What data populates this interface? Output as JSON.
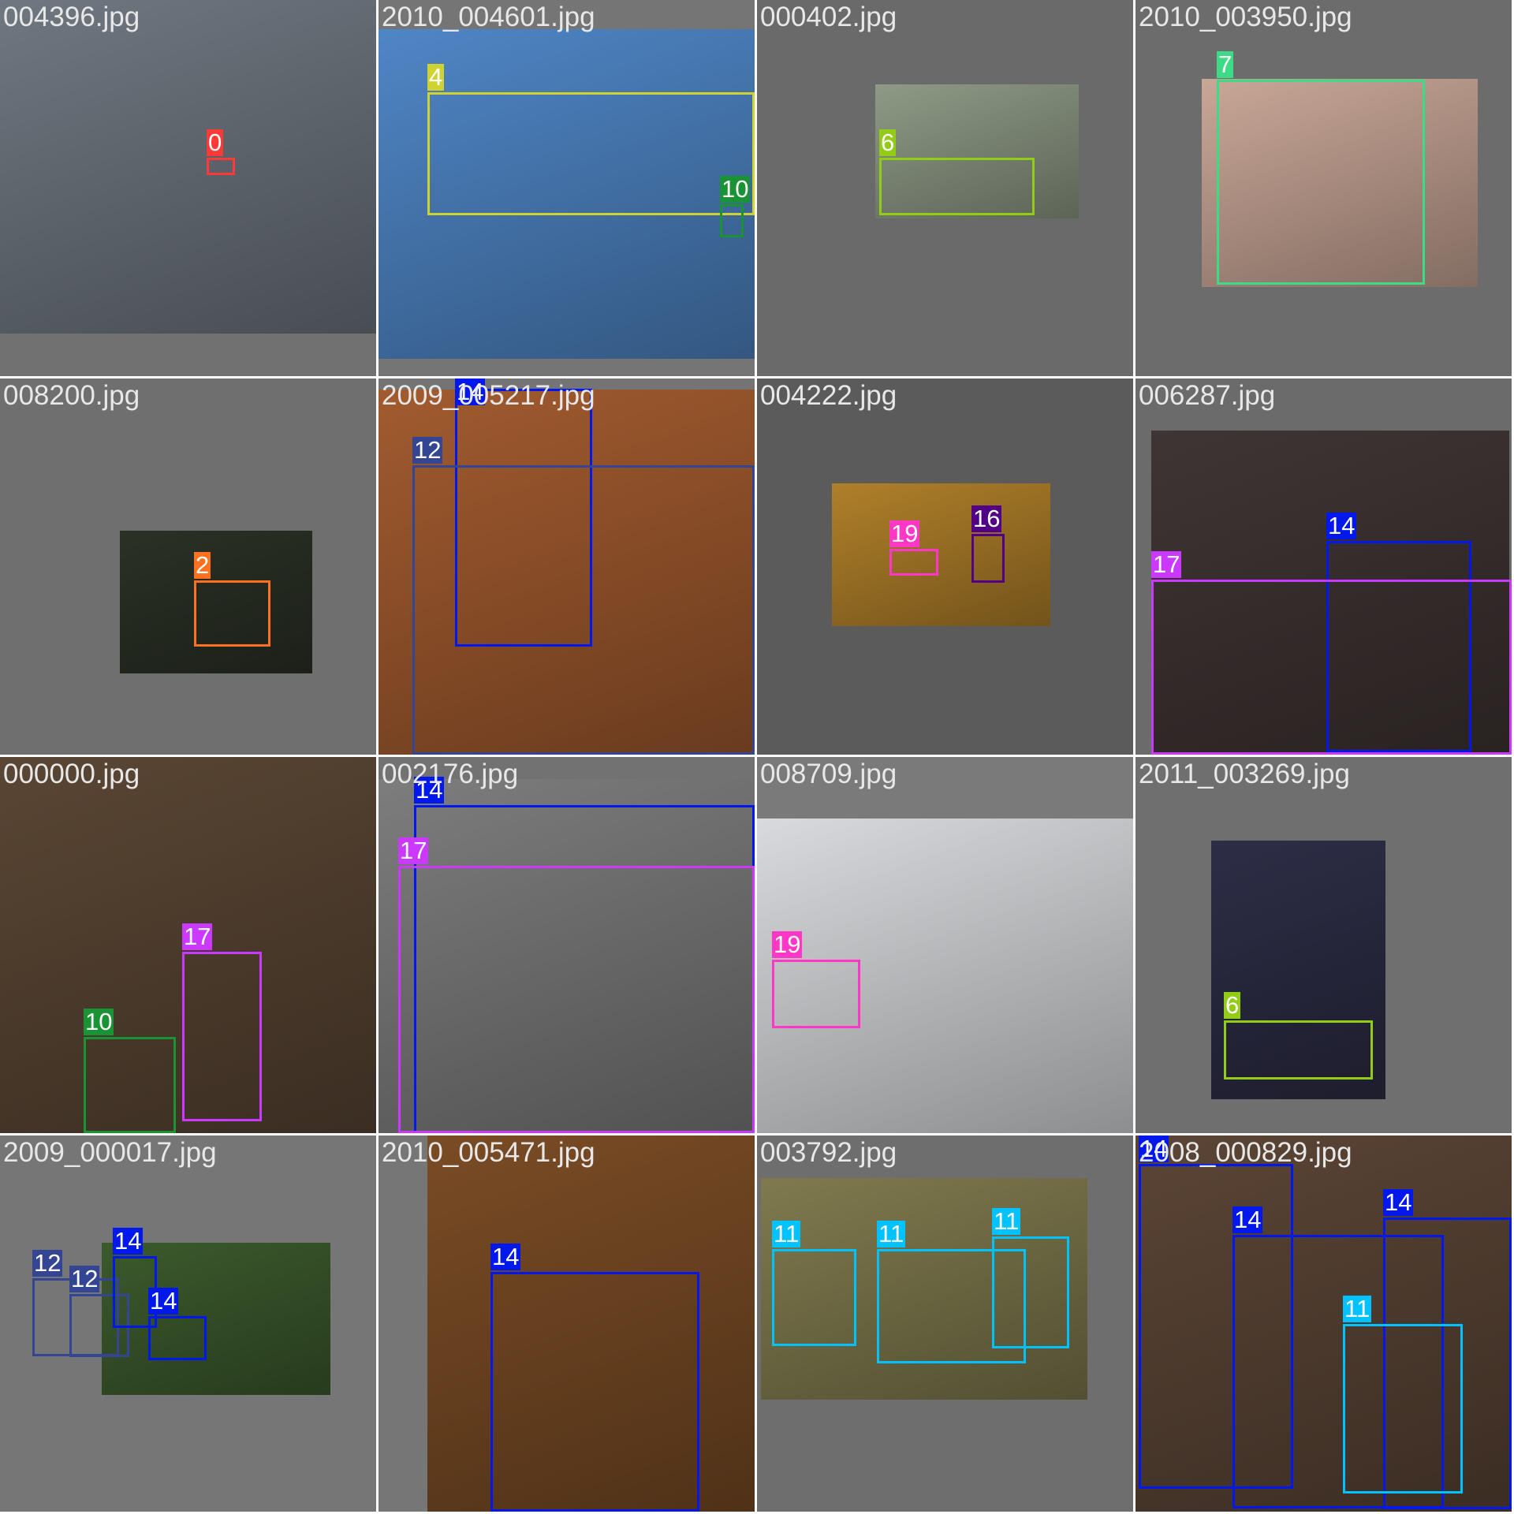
{
  "tiles": [
    {
      "file": "004396.jpg",
      "bg": "#717171",
      "photo_color": "#6f7780",
      "boxes": [
        {
          "cls": "0",
          "color": "#ff3838"
        }
      ]
    },
    {
      "file": "2010_004601.jpg",
      "bg": "#757575",
      "photo_color": "#4f86c6",
      "boxes": [
        {
          "cls": "4",
          "color": "#cfd231"
        },
        {
          "cls": "10",
          "color": "#1a9334"
        }
      ]
    },
    {
      "file": "000402.jpg",
      "bg": "#6a6a6a",
      "photo_color": "#8e9a86",
      "boxes": [
        {
          "cls": "6",
          "color": "#92cc17"
        }
      ]
    },
    {
      "file": "2010_003950.jpg",
      "bg": "#6c6c6c",
      "photo_color": "#c9a797",
      "boxes": [
        {
          "cls": "7",
          "color": "#3ddb86"
        }
      ]
    },
    {
      "file": "008200.jpg",
      "bg": "#6f6f6f",
      "photo_color": "#2b3126",
      "boxes": [
        {
          "cls": "2",
          "color": "#ff701f"
        }
      ]
    },
    {
      "file": "2009_005217.jpg",
      "bg": "#747474",
      "photo_color": "#a25b2f",
      "boxes": [
        {
          "cls": "14",
          "color": "#0018ec"
        },
        {
          "cls": "12",
          "color": "#344593"
        }
      ]
    },
    {
      "file": "004222.jpg",
      "bg": "#5b5b5b",
      "photo_color": "#b0802a",
      "boxes": [
        {
          "cls": "19",
          "color": "#ff37c7"
        },
        {
          "cls": "16",
          "color": "#520085"
        }
      ]
    },
    {
      "file": "006287.jpg",
      "bg": "#6b6b6b",
      "photo_color": "#3f3534",
      "boxes": [
        {
          "cls": "14",
          "color": "#0018ec"
        },
        {
          "cls": "17",
          "color": "#cb38ff"
        }
      ]
    },
    {
      "file": "000000.jpg",
      "bg": "#6d6d6d",
      "photo_color": "#5a4634",
      "boxes": [
        {
          "cls": "17",
          "color": "#cb38ff"
        },
        {
          "cls": "10",
          "color": "#1a9334"
        }
      ]
    },
    {
      "file": "002176.jpg",
      "bg": "#727272",
      "photo_color": "#7d7d7d",
      "boxes": [
        {
          "cls": "14",
          "color": "#0018ec"
        },
        {
          "cls": "17",
          "color": "#cb38ff"
        }
      ]
    },
    {
      "file": "008709.jpg",
      "bg": "#7a7a7a",
      "photo_color": "#d8dadd",
      "boxes": [
        {
          "cls": "19",
          "color": "#ff37c7"
        }
      ]
    },
    {
      "file": "2011_003269.jpg",
      "bg": "#6f6f6f",
      "photo_color": "#2d2d46",
      "boxes": [
        {
          "cls": "6",
          "color": "#92cc17"
        }
      ]
    },
    {
      "file": "2009_000017.jpg",
      "bg": "#767676",
      "photo_color": "#3c5a2d",
      "boxes": [
        {
          "cls": "12",
          "color": "#344593"
        },
        {
          "cls": "12",
          "color": "#344593"
        },
        {
          "cls": "14",
          "color": "#0018ec"
        },
        {
          "cls": "14",
          "color": "#0018ec"
        }
      ]
    },
    {
      "file": "2010_005471.jpg",
      "bg": "#767676",
      "photo_color": "#7a4c25",
      "boxes": [
        {
          "cls": "14",
          "color": "#0018ec"
        }
      ]
    },
    {
      "file": "003792.jpg",
      "bg": "#6e6e6e",
      "photo_color": "#7f7a4e",
      "boxes": [
        {
          "cls": "11",
          "color": "#00c2ff"
        },
        {
          "cls": "11",
          "color": "#00c2ff"
        },
        {
          "cls": "11",
          "color": "#00c2ff"
        }
      ]
    },
    {
      "file": "2008_000829.jpg",
      "bg": "#6a6a6a",
      "photo_color": "#5b4536",
      "boxes": [
        {
          "cls": "14",
          "color": "#0018ec"
        },
        {
          "cls": "14",
          "color": "#0018ec"
        },
        {
          "cls": "14",
          "color": "#0018ec"
        },
        {
          "cls": "11",
          "color": "#00c2ff"
        }
      ]
    }
  ]
}
